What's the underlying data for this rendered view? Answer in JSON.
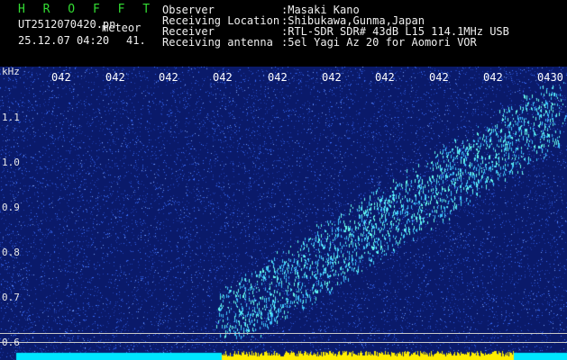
{
  "header": {
    "app_name": "H R O F F T",
    "file_name": "UT2512070420.pn",
    "tag": "meteor",
    "datetime": "25.12.07 04:20",
    "count": "41.",
    "labels": [
      "Observer",
      "Receiving Location",
      "Receiver",
      "Receiving antenna"
    ],
    "values": [
      ":Masaki Kano",
      ":Shibukawa,Gunma,Japan",
      ":RTL-SDR SDR# 43dB L15 114.1MHz USB",
      ":5el Yagi Az 20 for Aomori VOR"
    ]
  },
  "plot": {
    "y_unit": "kHz",
    "y_ticks": [
      "1.1",
      "1.0",
      "0.9",
      "0.8",
      "0.7",
      "0.6"
    ],
    "x_ticks": [
      "042",
      "042",
      "042",
      "042",
      "042",
      "042",
      "042",
      "042",
      "042",
      "0430"
    ],
    "colors": {
      "background": "#0a1a6a",
      "noise": "#3a70ff",
      "signal": "#66ffee",
      "baseline_cyan": "#00e5ff",
      "baseline_yellow": "#ffee00"
    }
  }
}
